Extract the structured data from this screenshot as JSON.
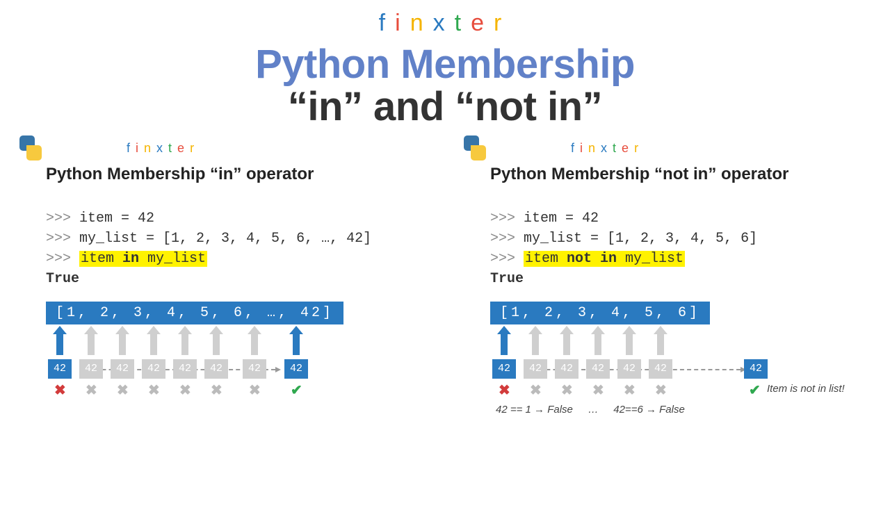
{
  "logo": {
    "letters": [
      "f",
      "i",
      "n",
      "x",
      "t",
      "e",
      "r"
    ],
    "colors": [
      "#2a7ac0",
      "#e74c3c",
      "#f5b400",
      "#2a7ac0",
      "#2fa84f",
      "#e74c3c",
      "#f5b400"
    ]
  },
  "title": {
    "line1": "Python Membership",
    "line2": "“in” and “not in”"
  },
  "panels": {
    "in": {
      "heading": "Python Membership “in” operator",
      "code": {
        "l1_prompt": ">>> ",
        "l1": "item = 42",
        "l2_prompt": ">>> ",
        "l2": "my_list = [1, 2, 3, 4, 5, 6, …, 42]",
        "l3_prompt": ">>> ",
        "l3_left": "item ",
        "l3_kw": "in",
        "l3_right": " my_list",
        "result": "True"
      },
      "listbar": "[1, 2, 3, 4, 5, 6, …, 42]",
      "box_value": "42"
    },
    "notin": {
      "heading": "Python Membership “not in” operator",
      "code": {
        "l1_prompt": ">>> ",
        "l1": "item = 42",
        "l2_prompt": ">>> ",
        "l2": "my_list = [1, 2, 3, 4, 5, 6]",
        "l3_prompt": ">>> ",
        "l3_left": "item ",
        "l3_kw": "not in",
        "l3_right": " my_list",
        "result": "True"
      },
      "listbar": "[1, 2, 3, 4, 5, 6]",
      "box_value": "42",
      "annotation": "Item is not in list!",
      "foot_left": "42 == 1 → False",
      "foot_mid": "…",
      "foot_right": "42==6 → False"
    }
  }
}
